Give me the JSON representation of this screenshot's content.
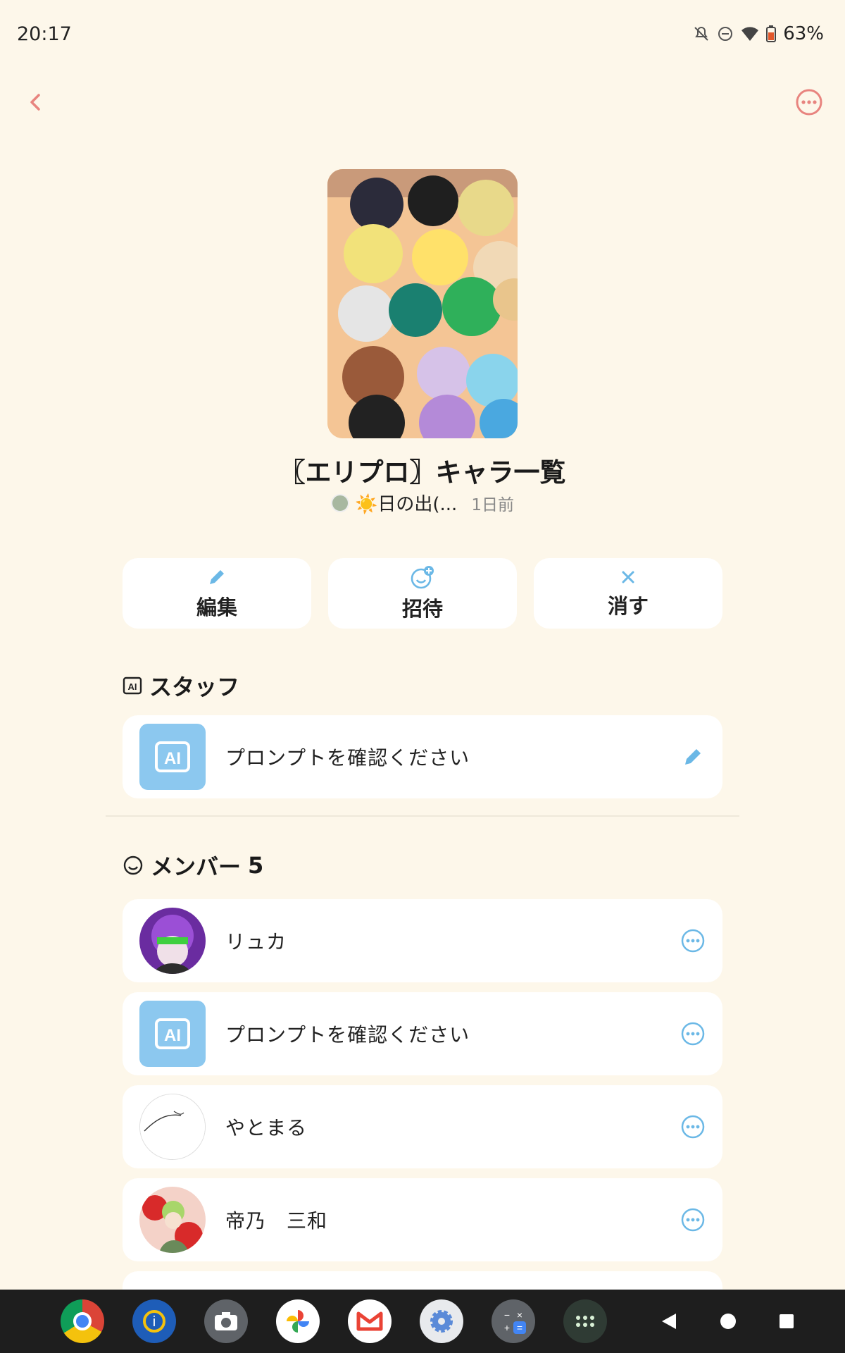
{
  "status_bar": {
    "time": "20:17",
    "battery": "63%"
  },
  "nav": {
    "back_icon": "chevron-left-icon",
    "more_icon": "more-horizontal-icon",
    "accent": "#e8847f"
  },
  "group": {
    "title": "〖エリプロ〗キャラ一覧",
    "creator": "☀️日の出(...",
    "created": "1日前"
  },
  "actions": {
    "edit": "編集",
    "invite": "招待",
    "delete": "消す"
  },
  "staff": {
    "title": "スタッフ",
    "items": [
      {
        "name": "プロンプトを確認ください",
        "avatar": "ai"
      }
    ]
  },
  "members": {
    "title": "メンバー",
    "count": "5",
    "items": [
      {
        "name": "リュカ",
        "avatar": "photo-purple"
      },
      {
        "name": "プロンプトを確認ください",
        "avatar": "ai"
      },
      {
        "name": "やとまる",
        "avatar": "sketch"
      },
      {
        "name": "帝乃　三和",
        "avatar": "photo-red"
      }
    ]
  },
  "colors": {
    "background": "#fdf7ea",
    "ai_blue": "#8cc8ef",
    "icon_blue": "#6bb8e6"
  },
  "dock": {
    "apps": [
      "chrome-icon",
      "ibispaint-icon",
      "camera-icon",
      "photos-icon",
      "gmail-icon",
      "settings-icon",
      "calculator-icon",
      "app-drawer-icon"
    ]
  }
}
